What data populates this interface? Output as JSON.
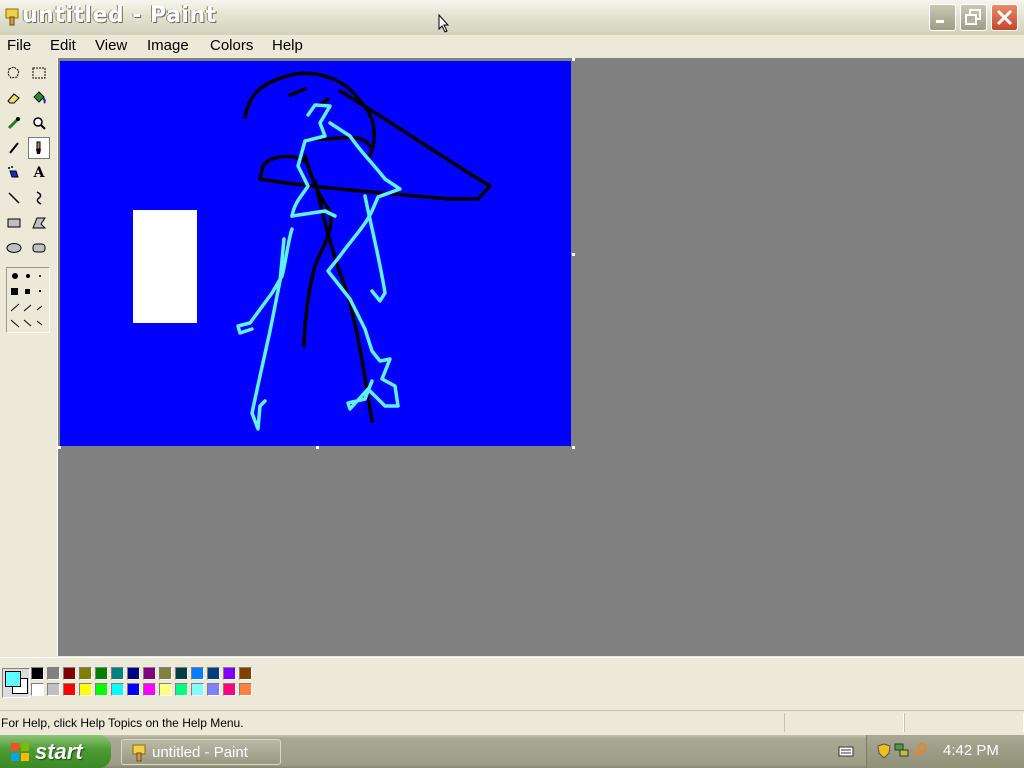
{
  "window": {
    "title": "untitled - Paint"
  },
  "menu": {
    "items": [
      "File",
      "Edit",
      "View",
      "Image",
      "Colors",
      "Help"
    ]
  },
  "toolbox": {
    "tools": [
      "free-form-select",
      "select",
      "eraser",
      "fill-with-color",
      "pick-color",
      "magnifier",
      "pencil",
      "brush",
      "airbrush",
      "text",
      "line",
      "curve",
      "rectangle",
      "polygon",
      "ellipse",
      "rounded-rectangle"
    ],
    "selected_tool": "brush",
    "text_tool_glyph": "A"
  },
  "canvas": {
    "background": "#0000ff"
  },
  "palette": {
    "foreground": "#60ffff",
    "background": "#ffffff",
    "top_row": [
      "#000000",
      "#808080",
      "#800000",
      "#808000",
      "#008000",
      "#008080",
      "#000080",
      "#800080",
      "#808040",
      "#004040",
      "#0080ff",
      "#004080",
      "#8000ff",
      "#804000"
    ],
    "bottom_row": [
      "#ffffff",
      "#c0c0c0",
      "#ff0000",
      "#ffff00",
      "#00ff00",
      "#00ffff",
      "#0000ff",
      "#ff00ff",
      "#ffff80",
      "#00ff80",
      "#80ffff",
      "#8080ff",
      "#ff0080",
      "#ff8040"
    ]
  },
  "status": {
    "text": "For Help, click Help Topics on the Help Menu."
  },
  "taskbar": {
    "start_label": "start",
    "task_label": "untitled - Paint",
    "clock": "4:42 PM"
  }
}
